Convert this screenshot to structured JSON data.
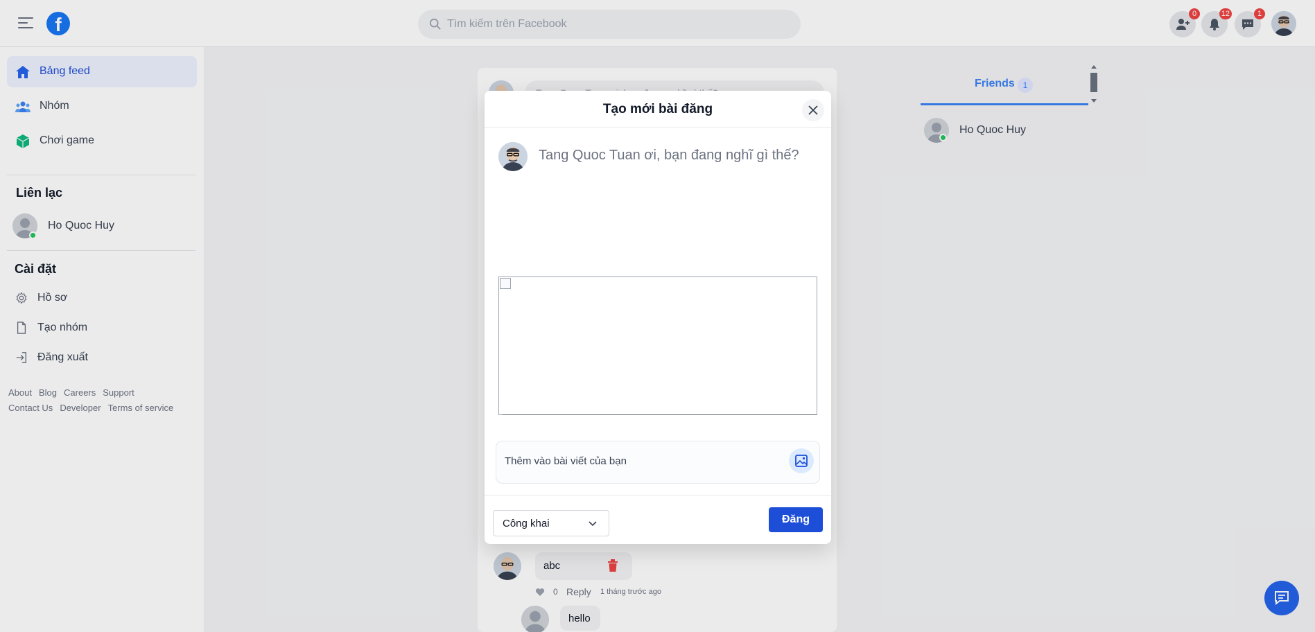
{
  "header": {
    "search_placeholder": "Tìm kiếm trên Facebook",
    "friend_requests_badge": "0",
    "notifications_badge": "12",
    "messages_badge": "1",
    "brand_color": "#1877f2"
  },
  "sidebar": {
    "nav": [
      {
        "label": "Bảng feed",
        "icon": "home-icon",
        "active": true
      },
      {
        "label": "Nhóm",
        "icon": "group-icon",
        "active": false
      },
      {
        "label": "Chơi game",
        "icon": "game-cube-icon",
        "active": false
      }
    ],
    "contacts_heading": "Liên lạc",
    "contacts": [
      {
        "name": "Ho Quoc Huy",
        "online": true
      }
    ],
    "settings_heading": "Cài đặt",
    "settings": [
      {
        "label": "Hồ sơ",
        "icon": "gear-icon"
      },
      {
        "label": "Tạo nhóm",
        "icon": "document-icon"
      },
      {
        "label": "Đăng xuất",
        "icon": "logout-icon"
      }
    ],
    "footer_links": [
      "About",
      "Blog",
      "Careers",
      "Support",
      "Contact Us",
      "Developer",
      "Terms of service"
    ]
  },
  "feed": {
    "composer_placeholder": "Tang Quoc Tuan ơi, bạn đang nghĩ gì thế?",
    "comment": {
      "text": "abc",
      "likes": "0",
      "reply_label": "Reply",
      "time": "1 tháng trước ago"
    },
    "reply": {
      "text": "hello"
    }
  },
  "right_panel": {
    "tab_label": "Friends",
    "tab_count": "1",
    "friends": [
      {
        "name": "Ho Quoc Huy",
        "online": true
      }
    ]
  },
  "modal": {
    "title": "Tạo mới bài đăng",
    "prompt": "Tang Quoc Tuan ơi, bạn đang nghĩ gì thế?",
    "add_to_post_label": "Thêm vào bài viết của bạn",
    "privacy_value": "Công khai",
    "post_button_label": "Đăng"
  }
}
